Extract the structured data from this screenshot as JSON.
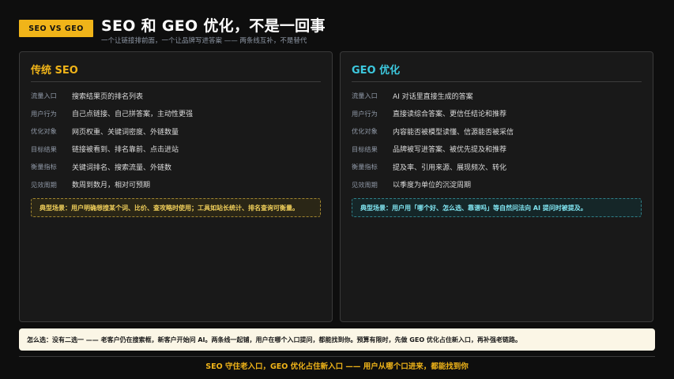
{
  "header": {
    "tag": "SEO VS GEO",
    "title": "SEO 和 GEO 优化，不是一回事",
    "subtitle": "一个让链接排前面，一个让品牌写进答案 —— 两条线互补，不是替代"
  },
  "colors": {
    "accent_gold": "#f0b419",
    "accent_cyan": "#3dc9df",
    "background": "#0e0e0e",
    "panel": "#191919",
    "advice_bg": "#fbf6e6"
  },
  "seo": {
    "title": "传统 SEO",
    "rows": [
      {
        "label": "流量入口",
        "value": "搜索结果页的排名列表"
      },
      {
        "label": "用户行为",
        "value": "自己点链接、自己拼答案，主动性更强"
      },
      {
        "label": "优化对象",
        "value": "网页权重、关键词密度、外链数量"
      },
      {
        "label": "目标结果",
        "value": "链接被看到、排名靠前、点击进站"
      },
      {
        "label": "衡量指标",
        "value": "关键词排名、搜索流量、外链数"
      },
      {
        "label": "见效周期",
        "value": "数周到数月，相对可预期"
      }
    ],
    "scenario": "典型场景：用户明确想搜某个词、比价、查攻略时使用；工具如站长统计、排名查询可衡量。"
  },
  "geo": {
    "title": "GEO 优化",
    "rows": [
      {
        "label": "流量入口",
        "value": "AI 对话里直接生成的答案"
      },
      {
        "label": "用户行为",
        "value": "直接读综合答案、更信任结论和推荐"
      },
      {
        "label": "优化对象",
        "value": "内容能否被模型读懂、信源能否被采信"
      },
      {
        "label": "目标结果",
        "value": "品牌被写进答案、被优先提及和推荐"
      },
      {
        "label": "衡量指标",
        "value": "提及率、引用来源、展现频次、转化"
      },
      {
        "label": "见效周期",
        "value": "以季度为单位的沉淀周期"
      }
    ],
    "scenario": "典型场景：用户用「哪个好、怎么选、靠谱吗」等自然问法向 AI 提问时被提及。"
  },
  "advice": "怎么选：没有二选一 —— 老客户仍在搜索框，新客户开始问 AI。两条线一起铺，用户在哪个入口提问，都能找到你。预算有限时，先做 GEO 优化占住新入口，再补强老链路。",
  "footer": "SEO 守住老入口，GEO 优化占住新入口 —— 用户从哪个口进来，都能找到你"
}
